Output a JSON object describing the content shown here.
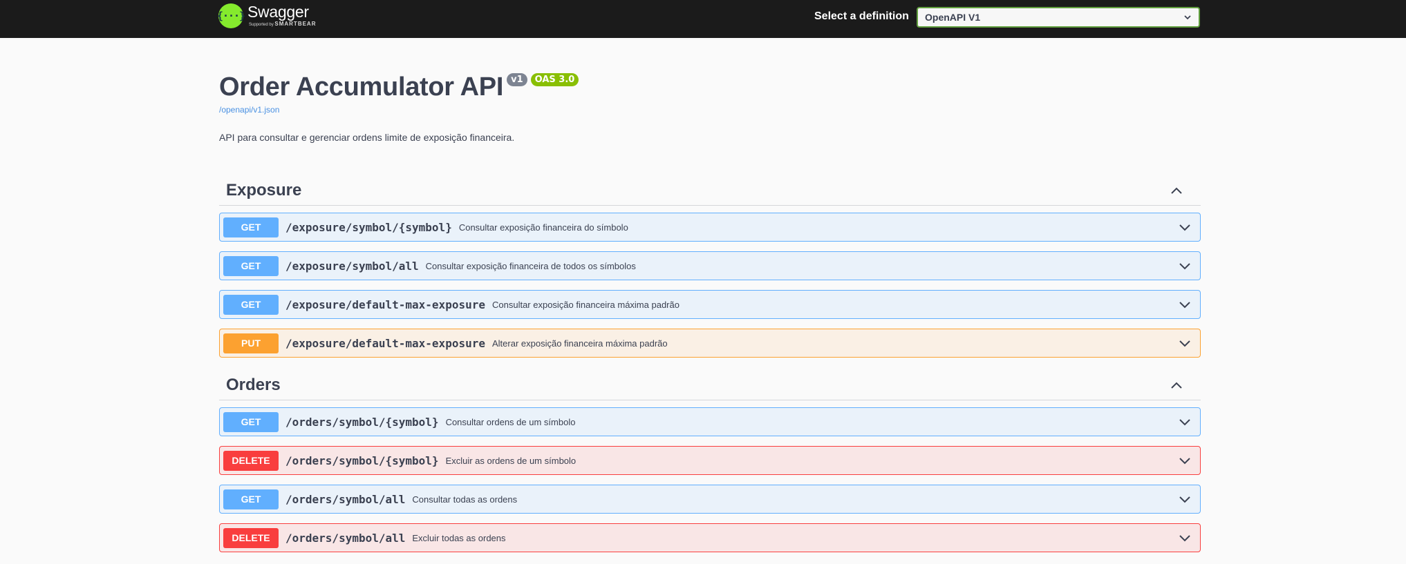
{
  "topbar": {
    "logo_glyph": "{···}",
    "logo_name": "Swagger",
    "logo_supported": "Supported by",
    "logo_company": "SMARTBEAR",
    "definition_label": "Select a definition",
    "definition_value": "OpenAPI V1"
  },
  "info": {
    "title": "Order Accumulator API",
    "version_badge": "v1",
    "oas_badge": "OAS 3.0",
    "spec_url": "/openapi/v1.json",
    "description": "API para consultar e gerenciar ordens limite de exposição financeira."
  },
  "tags": [
    {
      "name": "Exposure",
      "operations": [
        {
          "method": "GET",
          "path": "/exposure/symbol/{symbol}",
          "summary": "Consultar exposição financeira do símbolo"
        },
        {
          "method": "GET",
          "path": "/exposure/symbol/all",
          "summary": "Consultar exposição financeira de todos os símbolos"
        },
        {
          "method": "GET",
          "path": "/exposure/default-max-exposure",
          "summary": "Consultar exposição financeira máxima padrão"
        },
        {
          "method": "PUT",
          "path": "/exposure/default-max-exposure",
          "summary": "Alterar exposição financeira máxima padrão"
        }
      ]
    },
    {
      "name": "Orders",
      "operations": [
        {
          "method": "GET",
          "path": "/orders/symbol/{symbol}",
          "summary": "Consultar ordens de um símbolo"
        },
        {
          "method": "DELETE",
          "path": "/orders/symbol/{symbol}",
          "summary": "Excluir as ordens de um símbolo"
        },
        {
          "method": "GET",
          "path": "/orders/symbol/all",
          "summary": "Consultar todas as ordens"
        },
        {
          "method": "DELETE",
          "path": "/orders/symbol/all",
          "summary": "Excluir todas as ordens"
        }
      ]
    }
  ],
  "colors": {
    "topbar_bg": "#1b1b1b",
    "logo_green": "#85ea2d",
    "get": "#61affe",
    "put": "#fca130",
    "delete": "#f93e3e",
    "oas_badge": "#89bf04",
    "version_badge": "#7d8492"
  },
  "icons": {
    "select_arrow": "chevron-down-icon",
    "section_toggle": "chevron-up-icon",
    "operation_toggle": "chevron-down-icon"
  }
}
